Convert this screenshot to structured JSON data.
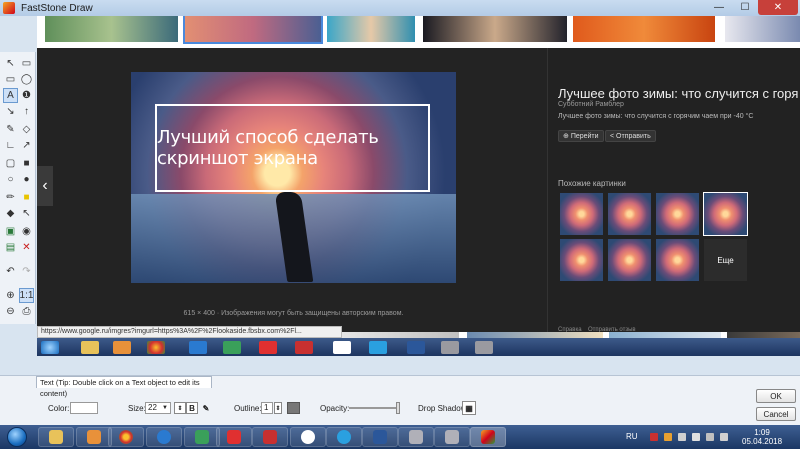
{
  "window": {
    "title": "FastStone Draw"
  },
  "overlay_text": "Лучший способ сделать скриншот экрана",
  "viewer": {
    "caption_dims": "615 × 400",
    "caption_text": "Изображения могут быть защищены авторским правом.",
    "side_title": "Лучшее фото зимы: что случится с горя...",
    "source": "Субботний Рамблер",
    "description": "Лучшее фото зимы: что случится с горячим чаем при -40 °С",
    "btn_go": "Перейти",
    "btn_share": "Отправить",
    "related_label": "Похожие картинки",
    "more_label": "Еще",
    "foot_help": "Справка",
    "foot_feedback": "Отправить отзыв"
  },
  "url": "https://www.google.ru/imgres?imgurl=https%3A%2F%2Flookaside.fbsbx.com%2Fl...",
  "props": {
    "tab_label": "Text (Tip: Double click on a Text object to edit its content)",
    "color_label": "Color:",
    "size_label": "Size:",
    "size_value": "22",
    "bold_label": "B",
    "outline_label": "Outline:",
    "outline_value": "1",
    "opacity_label": "Opacity:",
    "opacity_level": 1.0,
    "shadow_label": "Drop Shadow:",
    "ok": "OK",
    "cancel": "Cancel"
  },
  "taskbar": {
    "lang": "RU",
    "time": "1:09",
    "date": "05.04.2018"
  },
  "colors": {
    "taskbar": "#1b3764",
    "viewer_bg": "#232323",
    "close": "#c7403a"
  }
}
